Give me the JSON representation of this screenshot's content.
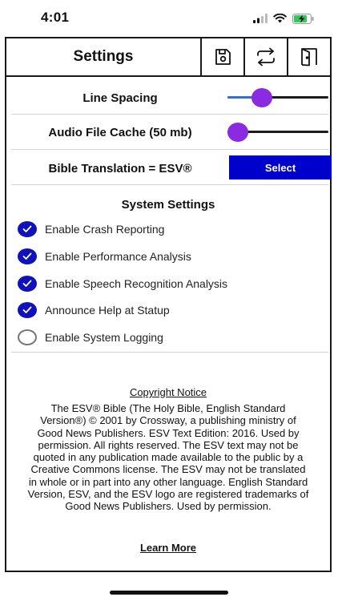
{
  "status_bar": {
    "time": "4:01",
    "battery_level": 0.8,
    "battery_color": "#34c759"
  },
  "header": {
    "title": "Settings",
    "icons": [
      "save-icon",
      "sync-icon",
      "exit-door-icon"
    ]
  },
  "settings": {
    "line_spacing": {
      "label": "Line Spacing",
      "value": 0.3
    },
    "audio_cache": {
      "label": "Audio File Cache (50 mb)",
      "value": 0.0
    },
    "translation": {
      "label": "Bible Translation = ESV®",
      "button": "Select"
    }
  },
  "system_settings": {
    "title": "System Settings",
    "items": [
      {
        "label": "Enable Crash Reporting",
        "checked": true
      },
      {
        "label": "Enable Performance Analysis",
        "checked": true
      },
      {
        "label": "Enable Speech Recognition Analysis",
        "checked": true
      },
      {
        "label": "Announce Help at Statup",
        "checked": true
      },
      {
        "label": "Enable System Logging",
        "checked": false
      }
    ]
  },
  "copyright": {
    "title": "Copyright Notice",
    "text": "The ESV® Bible (The Holy Bible, English Standard Version®) © 2001 by Crossway, a publishing ministry of Good News Publishers. ESV Text Edition: 2016. Used by permission. All rights reserved. The ESV text may not be quoted in any publication made available to the public by a Creative Commons license. The ESV may not be translated in whole or in part into any other language. English Standard Version, ESV, and the ESV logo are registered trademarks of Good News Publishers. Used by permission.",
    "link": "Learn More"
  },
  "colors": {
    "accent": "#0000cc",
    "thumb": "#8a2be2",
    "slider_fill": "#2f6fe0"
  }
}
